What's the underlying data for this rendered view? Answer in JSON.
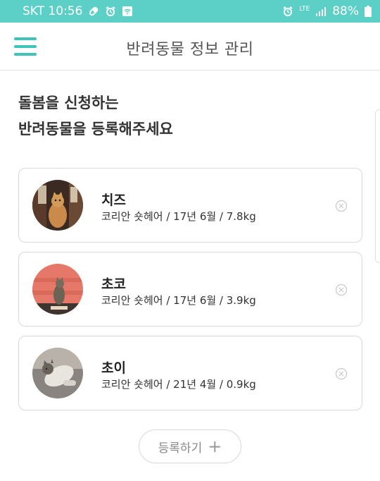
{
  "status_bar": {
    "carrier_time": "SKT 10:56",
    "network": "LTE",
    "battery": "88%"
  },
  "header": {
    "title": "반려동물 정보 관리"
  },
  "heading": {
    "line1": "돌봄을 신청하는",
    "line2": "반려동물을 등록해주세요"
  },
  "pets": [
    {
      "name": "치즈",
      "detail": "코리안 숏헤어 / 17년 6월 / 7.8kg"
    },
    {
      "name": "초코",
      "detail": "코리안 숏헤어 / 17년 6월 / 3.9kg"
    },
    {
      "name": "초이",
      "detail": "코리안 숏헤어 / 21년 4월 / 0.9kg"
    }
  ],
  "register_button": {
    "label": "등록하기",
    "icon": "+"
  },
  "colors": {
    "accent": "#5ccfc7",
    "menu": "#3fc4bb"
  }
}
